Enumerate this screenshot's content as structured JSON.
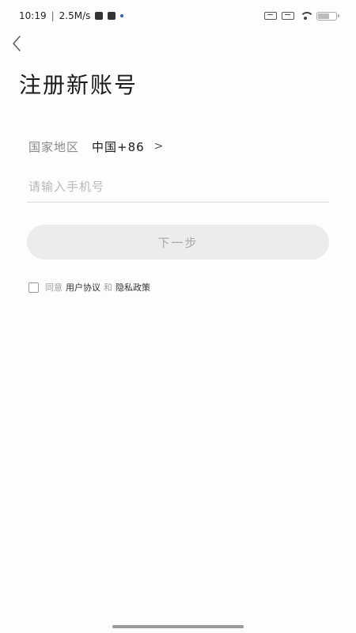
{
  "status_bar": {
    "time": "10:19",
    "divider": "|",
    "network_speed": "2.5M/s",
    "icons": [
      "notification-icon",
      "app-icon",
      "dot-icon",
      "sim-icon",
      "wifi-icon",
      "battery-icon"
    ],
    "battery_level": 0.6
  },
  "header": {
    "back_icon": "chevron-left-icon",
    "title": "注册新账号"
  },
  "form": {
    "country_label": "国家地区",
    "country_value": "中国+86",
    "country_chevron": ">",
    "phone_placeholder": "请输入手机号",
    "phone_value": "",
    "next_label": "下一步"
  },
  "agreement": {
    "checked": false,
    "prefix": "同意",
    "user_agreement": "用户协议",
    "and": "和",
    "privacy_policy": "隐私政策"
  },
  "colors": {
    "background": "#fdfdfd",
    "button_disabled_bg": "#ececec",
    "button_disabled_text": "#a8a8a8",
    "placeholder": "#b9b9b9",
    "label_gray": "#8a8a8a"
  }
}
